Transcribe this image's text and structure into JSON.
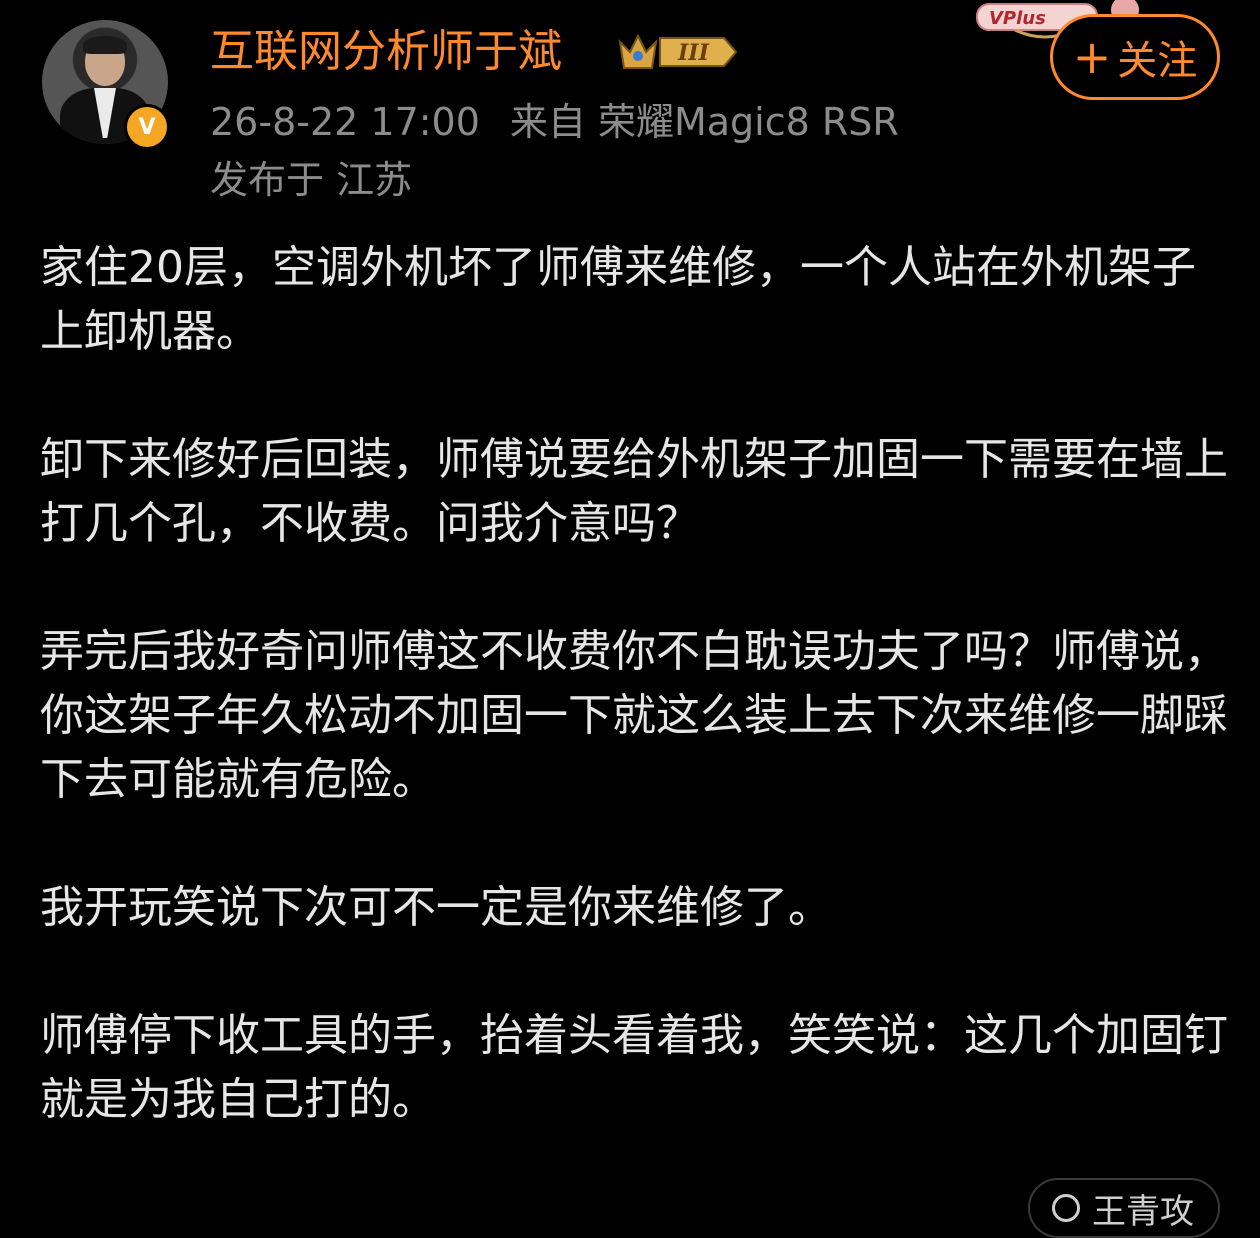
{
  "author": {
    "name": "互联网分析师于斌",
    "verified_badge": "V",
    "level_badge": "III",
    "avatar_icon": "user-avatar"
  },
  "post_meta": {
    "datetime": "26-8-22 17:00",
    "source": "来自 荣耀Magic8 RSR",
    "location": "发布于 江苏"
  },
  "decor": {
    "vplus_label": "VPlus"
  },
  "follow": {
    "label": "关注",
    "icon": "plus-icon"
  },
  "post": {
    "paragraphs": [
      "家住20层，空调外机坏了师傅来维修，一个人站在外机架子上卸机器。",
      "卸下来修好后回装，师傅说要给外机架子加固一下需要在墙上打几个孔，不收费。问我介意吗？",
      "弄完后我好奇问师傅这不收费你不白耽误功夫了吗？师傅说，你这架子年久松动不加固一下就这么装上去下次来维修一脚踩下去可能就有危险。",
      "我开玩笑说下次可不一定是你来维修了。",
      "师傅停下收工具的手，抬着头看着我，笑笑说：这几个加固钉就是为我自己打的。"
    ]
  },
  "bottom_chip": {
    "label": "王青攻"
  },
  "colors": {
    "background": "#000000",
    "accent": "#ff8a2d",
    "meta_text": "#8c8c8c",
    "body_text": "#e6e6e6",
    "verified": "#f5a623"
  }
}
